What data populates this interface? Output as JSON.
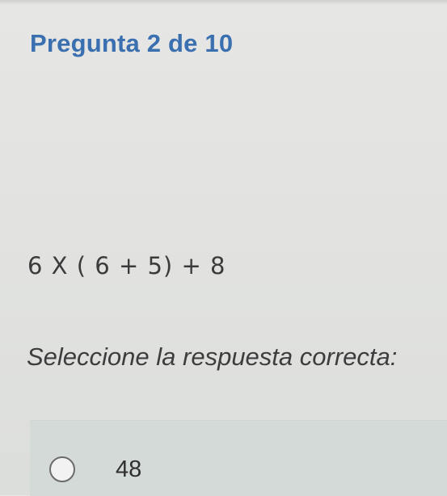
{
  "question": {
    "title": "Pregunta 2 de 10",
    "expression": "6 X ( 6 + 5) + 8",
    "instruction": "Seleccione la respuesta correcta:"
  },
  "options": [
    {
      "label": "48",
      "selected": false
    }
  ],
  "colors": {
    "title": "#3a6fb0",
    "background": "#e2e3e1",
    "option_background": "#d4dad8"
  }
}
